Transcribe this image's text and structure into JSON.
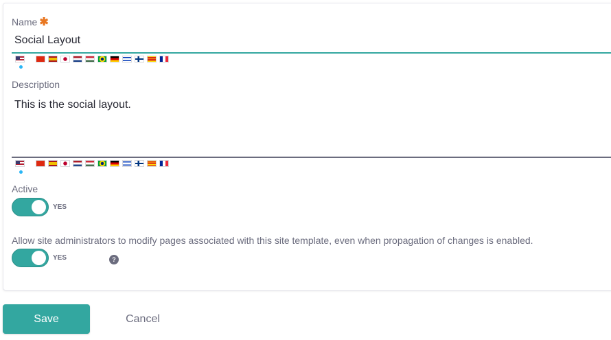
{
  "name_field": {
    "label": "Name",
    "required_marker": "✱",
    "value": "Social Layout"
  },
  "description_field": {
    "label": "Description",
    "value": "This is the social layout."
  },
  "active_toggle": {
    "label": "Active",
    "state_label": "YES",
    "on": true
  },
  "propagation_toggle": {
    "label": "Allow site administrators to modify pages associated with this site template, even when propagation of changes is enabled.",
    "state_label": "YES",
    "on": true,
    "help_icon": "?"
  },
  "language_flags": [
    "us",
    "cn",
    "es",
    "jp",
    "nl",
    "hu",
    "br",
    "de",
    "il",
    "fi",
    "ca",
    "fr"
  ],
  "colors": {
    "accent": "#33a7a0",
    "required": "#e87722",
    "label": "#6b6c7e"
  },
  "actions": {
    "save_label": "Save",
    "cancel_label": "Cancel"
  }
}
